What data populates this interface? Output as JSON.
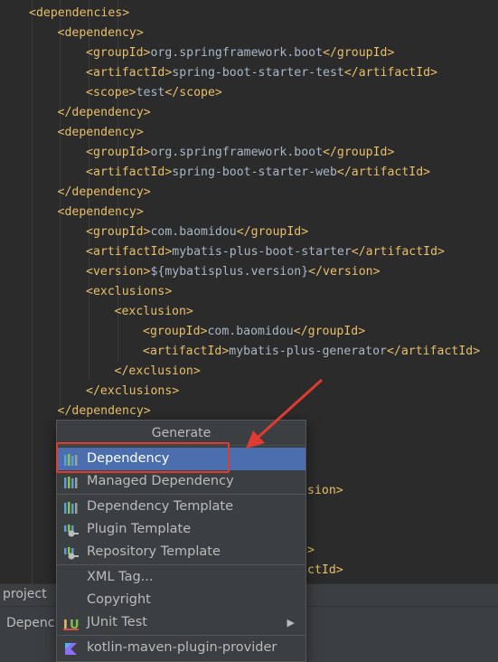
{
  "code_lines": [
    {
      "indent": 0,
      "open": "dependencies",
      "text": "",
      "close": ""
    },
    {
      "indent": 1,
      "open": "dependency",
      "text": "",
      "close": ""
    },
    {
      "indent": 2,
      "open": "groupId",
      "text": "org.springframework.boot",
      "close": "groupId"
    },
    {
      "indent": 2,
      "open": "artifactId",
      "text": "spring-boot-starter-test",
      "close": "artifactId"
    },
    {
      "indent": 2,
      "open": "scope",
      "text": "test",
      "close": "scope"
    },
    {
      "indent": 1,
      "open": "",
      "text": "",
      "close": "dependency"
    },
    {
      "indent": 1,
      "open": "dependency",
      "text": "",
      "close": ""
    },
    {
      "indent": 2,
      "open": "groupId",
      "text": "org.springframework.boot",
      "close": "groupId"
    },
    {
      "indent": 2,
      "open": "artifactId",
      "text": "spring-boot-starter-web",
      "close": "artifactId"
    },
    {
      "indent": 1,
      "open": "",
      "text": "",
      "close": "dependency"
    },
    {
      "indent": 1,
      "open": "dependency",
      "text": "",
      "close": ""
    },
    {
      "indent": 2,
      "open": "groupId",
      "text": "com.baomidou",
      "close": "groupId"
    },
    {
      "indent": 2,
      "open": "artifactId",
      "text": "mybatis-plus-boot-starter",
      "close": "artifactId"
    },
    {
      "indent": 2,
      "open": "version",
      "text": "${mybatisplus.version}",
      "close": "version"
    },
    {
      "indent": 2,
      "open": "exclusions",
      "text": "",
      "close": ""
    },
    {
      "indent": 3,
      "open": "exclusion",
      "text": "",
      "close": ""
    },
    {
      "indent": 4,
      "open": "groupId",
      "text": "com.baomidou",
      "close": "groupId"
    },
    {
      "indent": 4,
      "open": "artifactId",
      "text": "mybatis-plus-generator",
      "close": "artifactId"
    },
    {
      "indent": 3,
      "open": "",
      "text": "",
      "close": "exclusion"
    },
    {
      "indent": 2,
      "open": "",
      "text": "",
      "close": "exclusions"
    },
    {
      "indent": 1,
      "open": "",
      "text": "",
      "close": "dependency"
    }
  ],
  "peek_fragments": [
    {
      "text": "sion>",
      "line": 24
    },
    {
      "text": ">",
      "line": 27
    },
    {
      "text": "ctId>",
      "line": 28
    }
  ],
  "project_tab": {
    "label": "project"
  },
  "bottom_tab": {
    "label": "Depenc"
  },
  "popup": {
    "title": "Generate",
    "items": [
      {
        "label": "Dependency",
        "icon": "maven-icon",
        "selected": true,
        "group": 0
      },
      {
        "label": "Managed Dependency",
        "icon": "maven-icon",
        "selected": false,
        "group": 0
      },
      {
        "label": "Dependency Template",
        "icon": "maven-icon",
        "selected": false,
        "group": 1
      },
      {
        "label": "Plugin Template",
        "icon": "plugin-icon",
        "selected": false,
        "group": 1
      },
      {
        "label": "Repository Template",
        "icon": "plugin-icon",
        "selected": false,
        "group": 1
      },
      {
        "label": "XML Tag...",
        "icon": "",
        "selected": false,
        "group": 2
      },
      {
        "label": "Copyright",
        "icon": "",
        "selected": false,
        "group": 2
      },
      {
        "label": "JUnit Test",
        "icon": "junit-icon",
        "selected": false,
        "group": 2,
        "submenu": true
      },
      {
        "label": "kotlin-maven-plugin-provider",
        "icon": "kotlin-icon",
        "selected": false,
        "group": 3
      }
    ]
  },
  "colors": {
    "tag": "#e8bf6a",
    "text": "#a9b7c6",
    "selection": "#4b6eaf",
    "highlight": "#e03b31"
  }
}
